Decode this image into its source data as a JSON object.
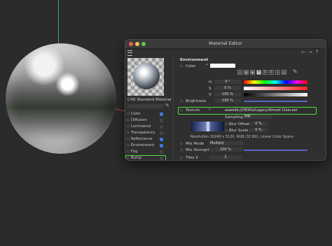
{
  "window_title": "Material Editor",
  "material_name": "C4D Standard Material",
  "channels": [
    {
      "label": "Color",
      "checked": true
    },
    {
      "label": "Diffusion",
      "checked": false
    },
    {
      "label": "Luminance",
      "checked": false
    },
    {
      "label": "Transparency",
      "checked": false
    },
    {
      "label": "Reflectance",
      "checked": true
    },
    {
      "label": "Environment",
      "checked": true
    },
    {
      "label": "Fog",
      "checked": false
    },
    {
      "label": "Bump",
      "checked": false
    }
  ],
  "section_title": "Environment",
  "color_label": "Color",
  "hsv": {
    "h_label": "H",
    "h_value": "0 °",
    "s_label": "S",
    "s_value": "0 %",
    "v_label": "V",
    "v_value": "100 %"
  },
  "brightness": {
    "label": "Brightness",
    "value": "100 %",
    "fill": 1.0
  },
  "texture": {
    "label": "Texture",
    "path": "assetdb:///HDRIs/Legacy/Almost Clear.exr"
  },
  "sampling": {
    "label": "Sampling",
    "value": "MIP"
  },
  "blur_offset": {
    "label": "Blur Offset",
    "value": "0 %"
  },
  "blur_scale": {
    "label": "Blur Scale",
    "value": "0 %"
  },
  "resolution": "Resolution 10240 x 5120, RGB (32 Bit), Linear Color Space",
  "mix_mode": {
    "label": "Mix Mode",
    "value": "Multiply"
  },
  "mix_strength": {
    "label": "Mix Strength",
    "value": "100 %",
    "fill": 1.0
  },
  "tiles_x": {
    "label": "Tiles X",
    "value": "1"
  },
  "colors": {
    "accent": "#3b76d9",
    "highlight": "#4fe03a"
  }
}
